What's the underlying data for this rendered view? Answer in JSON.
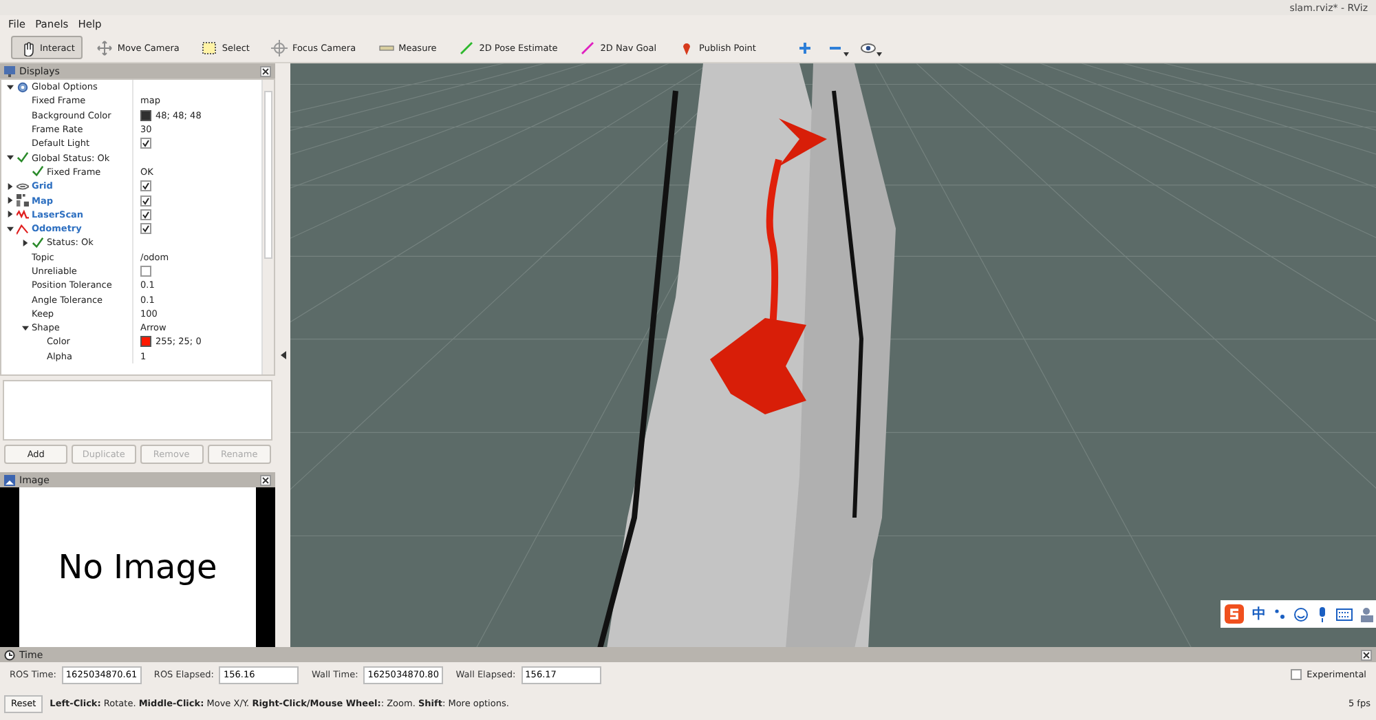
{
  "window": {
    "title": "slam.rviz* - RViz"
  },
  "menu": [
    "File",
    "Panels",
    "Help"
  ],
  "tools": [
    {
      "label": "Interact",
      "selected": true
    },
    {
      "label": "Move Camera",
      "selected": false
    },
    {
      "label": "Select",
      "selected": false
    },
    {
      "label": "Focus Camera",
      "selected": false
    },
    {
      "label": "Measure",
      "selected": false
    },
    {
      "label": "2D Pose Estimate",
      "selected": false
    },
    {
      "label": "2D Nav Goal",
      "selected": false
    },
    {
      "label": "Publish Point",
      "selected": false
    }
  ],
  "view_tools": [
    {
      "has_menu": false
    },
    {
      "has_menu": true
    },
    {
      "has_menu": true
    }
  ],
  "displays": {
    "title": "Displays",
    "tree": [
      {
        "label": "Global Options",
        "kind": "group",
        "expanded": true,
        "children": [
          {
            "label": "Fixed Frame",
            "kind": "text",
            "value": "map"
          },
          {
            "label": "Background Color",
            "kind": "color",
            "color": "#303030",
            "value": "48; 48; 48"
          },
          {
            "label": "Frame Rate",
            "kind": "text",
            "value": "30"
          },
          {
            "label": "Default Light",
            "kind": "check",
            "checked": true
          }
        ]
      },
      {
        "label": "Global Status: Ok",
        "kind": "group",
        "ok": true,
        "expanded": true,
        "children": [
          {
            "label": "Fixed Frame",
            "kind": "status",
            "ok": true,
            "value": "OK"
          }
        ]
      },
      {
        "label": "Grid",
        "kind": "display",
        "expanded": false,
        "checked": true
      },
      {
        "label": "Map",
        "kind": "display",
        "expanded": false,
        "checked": true
      },
      {
        "label": "LaserScan",
        "kind": "display",
        "expanded": false,
        "checked": true
      },
      {
        "label": "Odometry",
        "kind": "display",
        "expanded": true,
        "checked": true,
        "children": [
          {
            "label": "Status: Ok",
            "kind": "group",
            "ok": true,
            "expanded": false
          },
          {
            "label": "Topic",
            "kind": "text",
            "value": "/odom"
          },
          {
            "label": "Unreliable",
            "kind": "check",
            "checked": false
          },
          {
            "label": "Position Tolerance",
            "kind": "text",
            "value": "0.1"
          },
          {
            "label": "Angle Tolerance",
            "kind": "text",
            "value": "0.1"
          },
          {
            "label": "Keep",
            "kind": "text",
            "value": "100"
          },
          {
            "label": "Shape",
            "kind": "group",
            "expanded": true,
            "value": "Arrow",
            "children": [
              {
                "label": "Color",
                "kind": "color",
                "color": "#ff1900",
                "value": "255; 25; 0"
              },
              {
                "label": "Alpha",
                "kind": "text",
                "value": "1"
              }
            ]
          }
        ]
      }
    ],
    "buttons": [
      {
        "label": "Add",
        "disabled": false
      },
      {
        "label": "Duplicate",
        "disabled": true
      },
      {
        "label": "Remove",
        "disabled": true
      },
      {
        "label": "Rename",
        "disabled": true
      }
    ]
  },
  "image_panel": {
    "title": "Image",
    "message": "No Image"
  },
  "ime_bar": {
    "label": "中"
  },
  "time_panel": {
    "title": "Time",
    "fields": [
      {
        "label": "ROS Time:",
        "value": "1625034870.61"
      },
      {
        "label": "ROS Elapsed:",
        "value": "156.16"
      },
      {
        "label": "Wall Time:",
        "value": "1625034870.80"
      },
      {
        "label": "Wall Elapsed:",
        "value": "156.17"
      }
    ],
    "experimental": {
      "label": "Experimental",
      "checked": false
    }
  },
  "status_bar": {
    "reset": "Reset",
    "help": "**Left-Click:** Rotate. **Middle-Click:** Move X/Y. **Right-Click/Mouse Wheel:**: Zoom. **Shift**: More options.",
    "fps": "5 fps"
  }
}
